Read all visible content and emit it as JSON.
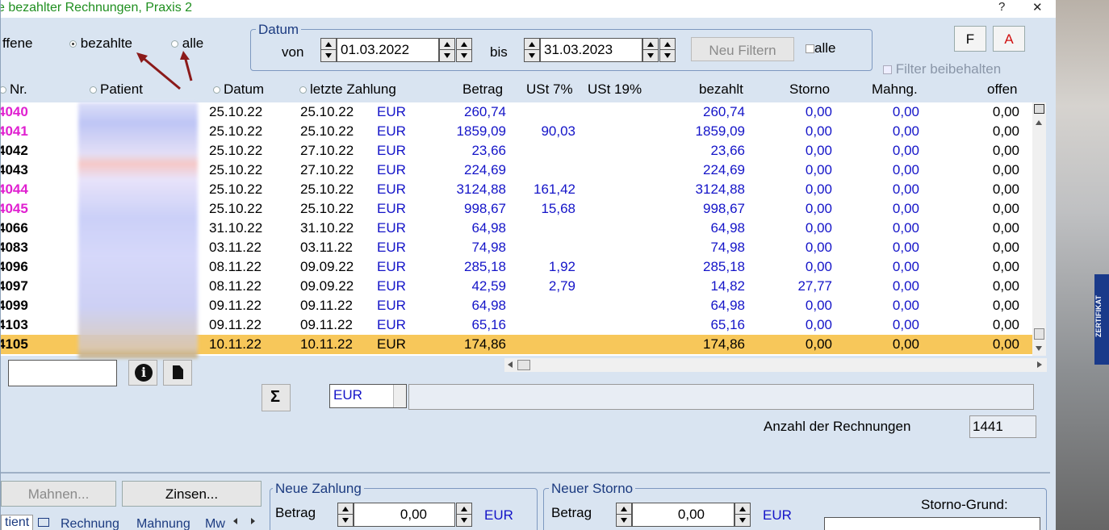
{
  "window": {
    "title": "e bezahlter Rechnungen, Praxis 2",
    "help": "?",
    "close": "✕"
  },
  "filter": {
    "offene": "ffene",
    "bezahlte": "bezahlte",
    "alle": "alle"
  },
  "datum": {
    "title": "Datum",
    "von_label": "von",
    "von": "01.03.2022",
    "bis_label": "bis",
    "bis": "31.03.2023",
    "neu_filtern": "Neu Filtern",
    "alle": "alle"
  },
  "buttons": {
    "f": "F",
    "a": "A"
  },
  "filter_beibehalten": "Filter beibehalten",
  "columns": {
    "nr": "Nr.",
    "patient": "Patient",
    "datum": "Datum",
    "letzte_zahlung": "letzte Zahlung",
    "betrag": "Betrag",
    "ust7": "USt 7%",
    "ust19": "USt 19%",
    "bezahlt": "bezahlt",
    "storno": "Storno",
    "mahng": "Mahng.",
    "offen": "offen"
  },
  "rows": [
    {
      "nr": "4040",
      "dt": "25.10.22",
      "lz": "25.10.22",
      "cur": "EUR",
      "bet": "260,74",
      "u7": "",
      "bez": "260,74",
      "sto": "0,00",
      "mah": "0,00",
      "off": "0,00",
      "color": "#e020d0"
    },
    {
      "nr": "4041",
      "dt": "25.10.22",
      "lz": "25.10.22",
      "cur": "EUR",
      "bet": "1859,09",
      "u7": "90,03",
      "bez": "1859,09",
      "sto": "0,00",
      "mah": "0,00",
      "off": "0,00",
      "color": "#e020d0"
    },
    {
      "nr": "4042",
      "dt": "25.10.22",
      "lz": "27.10.22",
      "cur": "EUR",
      "bet": "23,66",
      "u7": "",
      "bez": "23,66",
      "sto": "0,00",
      "mah": "0,00",
      "off": "0,00",
      "color": "#000000"
    },
    {
      "nr": "4043",
      "dt": "25.10.22",
      "lz": "27.10.22",
      "cur": "EUR",
      "bet": "224,69",
      "u7": "",
      "bez": "224,69",
      "sto": "0,00",
      "mah": "0,00",
      "off": "0,00",
      "color": "#000000"
    },
    {
      "nr": "4044",
      "dt": "25.10.22",
      "lz": "25.10.22",
      "cur": "EUR",
      "bet": "3124,88",
      "u7": "161,42",
      "bez": "3124,88",
      "sto": "0,00",
      "mah": "0,00",
      "off": "0,00",
      "color": "#e020d0"
    },
    {
      "nr": "4045",
      "dt": "25.10.22",
      "lz": "25.10.22",
      "cur": "EUR",
      "bet": "998,67",
      "u7": "15,68",
      "bez": "998,67",
      "sto": "0,00",
      "mah": "0,00",
      "off": "0,00",
      "color": "#e020d0"
    },
    {
      "nr": "4066",
      "dt": "31.10.22",
      "lz": "31.10.22",
      "cur": "EUR",
      "bet": "64,98",
      "u7": "",
      "bez": "64,98",
      "sto": "0,00",
      "mah": "0,00",
      "off": "0,00",
      "color": "#000000"
    },
    {
      "nr": "4083",
      "dt": "03.11.22",
      "lz": "03.11.22",
      "cur": "EUR",
      "bet": "74,98",
      "u7": "",
      "bez": "74,98",
      "sto": "0,00",
      "mah": "0,00",
      "off": "0,00",
      "color": "#000000"
    },
    {
      "nr": "4096",
      "dt": "08.11.22",
      "lz": "09.09.22",
      "cur": "EUR",
      "bet": "285,18",
      "u7": "1,92",
      "bez": "285,18",
      "sto": "0,00",
      "mah": "0,00",
      "off": "0,00",
      "color": "#000000"
    },
    {
      "nr": "4097",
      "dt": "08.11.22",
      "lz": "09.09.22",
      "cur": "EUR",
      "bet": "42,59",
      "u7": "2,79",
      "bez": "14,82",
      "sto": "27,77",
      "mah": "0,00",
      "off": "0,00",
      "color": "#000000"
    },
    {
      "nr": "4099",
      "dt": "09.11.22",
      "lz": "09.11.22",
      "cur": "EUR",
      "bet": "64,98",
      "u7": "",
      "bez": "64,98",
      "sto": "0,00",
      "mah": "0,00",
      "off": "0,00",
      "color": "#000000"
    },
    {
      "nr": "4103",
      "dt": "09.11.22",
      "lz": "09.11.22",
      "cur": "EUR",
      "bet": "65,16",
      "u7": "",
      "bez": "65,16",
      "sto": "0,00",
      "mah": "0,00",
      "off": "0,00",
      "color": "#000000"
    },
    {
      "nr": "4105",
      "dt": "10.11.22",
      "lz": "10.11.22",
      "cur": "EUR",
      "bet": "174,86",
      "u7": "",
      "bez": "174,86",
      "sto": "0,00",
      "mah": "0,00",
      "off": "0,00",
      "color": "#000000",
      "selected": true
    }
  ],
  "search": {
    "value": ""
  },
  "sum": {
    "sigma": "Σ",
    "currency": "EUR"
  },
  "anzahl": {
    "label": "Anzahl der Rechnungen",
    "value": "1441"
  },
  "bottom": {
    "mahnen": "Mahnen...",
    "zinsen": "Zinsen...",
    "neue_zahlung": "Neue Zahlung",
    "neuer_storno": "Neuer Storno",
    "betrag": "Betrag",
    "zahlung_value": "0,00",
    "storno_value": "0,00",
    "eur": "EUR",
    "storno_grund": "Storno-Grund:",
    "tabs": [
      "tient",
      "Rechnung",
      "Mahnung",
      "Mw"
    ]
  },
  "sidebar_text": "ZERTIFIKAT"
}
